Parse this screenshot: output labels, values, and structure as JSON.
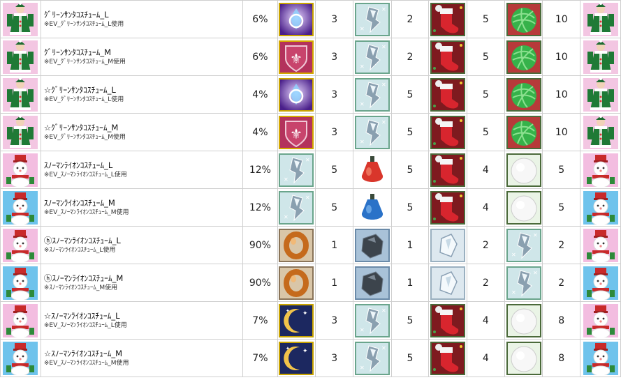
{
  "rows": [
    {
      "costume": "green",
      "name": "ｸﾞﾘｰﾝｻﾝﾀｺｽﾁｭｰﾑ_L",
      "note": "※EV_ｸﾞﾘｰﾝｻﾝﾀｺｽﾁｭｰﾑ_L使用",
      "rate": "6%",
      "mats": [
        {
          "icon": "magic-drop-icon",
          "qty": "3"
        },
        {
          "icon": "crystal-shard-icon",
          "qty": "2"
        },
        {
          "icon": "christmas-stocking-icon",
          "qty": "5"
        },
        {
          "icon": "green-yarn-ball-icon",
          "qty": "10"
        }
      ]
    },
    {
      "costume": "green",
      "name": "ｸﾞﾘｰﾝｻﾝﾀｺｽﾁｭｰﾑ_M",
      "note": "※EV_ｸﾞﾘｰﾝｻﾝﾀｺｽﾁｭｰﾑ_M使用",
      "rate": "6%",
      "mats": [
        {
          "icon": "fleur-de-lis-shield-icon",
          "qty": "3"
        },
        {
          "icon": "crystal-shard-icon",
          "qty": "2"
        },
        {
          "icon": "christmas-stocking-icon",
          "qty": "5"
        },
        {
          "icon": "green-yarn-ball-icon",
          "qty": "10"
        }
      ]
    },
    {
      "costume": "green",
      "name": "☆ｸﾞﾘｰﾝｻﾝﾀｺｽﾁｭｰﾑ_L",
      "note": "※EV_ｸﾞﾘｰﾝｻﾝﾀｺｽﾁｭｰﾑ_L使用",
      "rate": "4%",
      "mats": [
        {
          "icon": "magic-drop-icon",
          "qty": "3"
        },
        {
          "icon": "crystal-shard-icon",
          "qty": "5"
        },
        {
          "icon": "christmas-stocking-icon",
          "qty": "5"
        },
        {
          "icon": "green-yarn-ball-icon",
          "qty": "10"
        }
      ]
    },
    {
      "costume": "green",
      "name": "☆ｸﾞﾘｰﾝｻﾝﾀｺｽﾁｭｰﾑ_M",
      "note": "※EV_ｸﾞﾘｰﾝｻﾝﾀｺｽﾁｭｰﾑ_M使用",
      "rate": "4%",
      "mats": [
        {
          "icon": "fleur-de-lis-shield-icon",
          "qty": "3"
        },
        {
          "icon": "crystal-shard-icon",
          "qty": "5"
        },
        {
          "icon": "christmas-stocking-icon",
          "qty": "5"
        },
        {
          "icon": "green-yarn-ball-icon",
          "qty": "10"
        }
      ]
    },
    {
      "costume": "snowpink",
      "name": "ｽﾉｰﾏﾝﾗｲｵﾝｺｽﾁｭｰﾑ_L",
      "note": "※EV_ｽﾉｰﾏﾝﾗｲｵﾝｺｽﾁｭｰﾑ_L使用",
      "rate": "12%",
      "mats": [
        {
          "icon": "crystal-shard-icon",
          "qty": "5"
        },
        {
          "icon": "red-potion-icon",
          "qty": "5"
        },
        {
          "icon": "christmas-stocking-icon",
          "qty": "4"
        },
        {
          "icon": "snowball-icon",
          "qty": "5"
        }
      ]
    },
    {
      "costume": "snowblue",
      "name": "ｽﾉｰﾏﾝﾗｲｵﾝｺｽﾁｭｰﾑ_M",
      "note": "※EV_ｽﾉｰﾏﾝﾗｲｵﾝｺｽﾁｭｰﾑ_M使用",
      "rate": "12%",
      "mats": [
        {
          "icon": "crystal-shard-icon",
          "qty": "5"
        },
        {
          "icon": "blue-potion-icon",
          "qty": "5"
        },
        {
          "icon": "christmas-stocking-icon",
          "qty": "4"
        },
        {
          "icon": "snowball-icon",
          "qty": "5"
        }
      ]
    },
    {
      "costume": "snowpink",
      "name": "ⓗｽﾉｰﾏﾝﾗｲｵﾝｺｽﾁｭｰﾑ_L",
      "note": "※ｽﾉｰﾏﾝﾗｲｵﾝｺｽﾁｭｰﾑ_L使用",
      "rate": "90%",
      "mats": [
        {
          "icon": "bronze-ring-icon",
          "qty": "1"
        },
        {
          "icon": "dark-ore-icon",
          "qty": "1"
        },
        {
          "icon": "ice-crystal-icon",
          "qty": "2"
        },
        {
          "icon": "crystal-shard-icon",
          "qty": "2"
        }
      ]
    },
    {
      "costume": "snowblue",
      "name": "ⓗｽﾉｰﾏﾝﾗｲｵﾝｺｽﾁｭｰﾑ_M",
      "note": "※ｽﾉｰﾏﾝﾗｲｵﾝｺｽﾁｭｰﾑ_M使用",
      "rate": "90%",
      "mats": [
        {
          "icon": "bronze-ring-icon",
          "qty": "1"
        },
        {
          "icon": "dark-ore-icon",
          "qty": "1"
        },
        {
          "icon": "ice-crystal-icon",
          "qty": "2"
        },
        {
          "icon": "crystal-shard-icon",
          "qty": "2"
        }
      ]
    },
    {
      "costume": "snowpink",
      "name": "☆ｽﾉｰﾏﾝﾗｲｵﾝｺｽﾁｭｰﾑ_L",
      "note": "※EV_ｽﾉｰﾏﾝﾗｲｵﾝｺｽﾁｭｰﾑ_L使用",
      "rate": "7%",
      "mats": [
        {
          "icon": "moon-icon",
          "qty": "3"
        },
        {
          "icon": "crystal-shard-icon",
          "qty": "5"
        },
        {
          "icon": "christmas-stocking-icon",
          "qty": "4"
        },
        {
          "icon": "snowball-icon",
          "qty": "8"
        }
      ]
    },
    {
      "costume": "snowblue",
      "name": "☆ｽﾉｰﾏﾝﾗｲｵﾝｺｽﾁｭｰﾑ_M",
      "note": "※EV_ｽﾉｰﾏﾝﾗｲｵﾝｺｽﾁｭｰﾑ_M使用",
      "rate": "7%",
      "mats": [
        {
          "icon": "moon-icon",
          "qty": "3"
        },
        {
          "icon": "crystal-shard-icon",
          "qty": "5"
        },
        {
          "icon": "christmas-stocking-icon",
          "qty": "4"
        },
        {
          "icon": "snowball-icon",
          "qty": "8"
        }
      ]
    }
  ]
}
